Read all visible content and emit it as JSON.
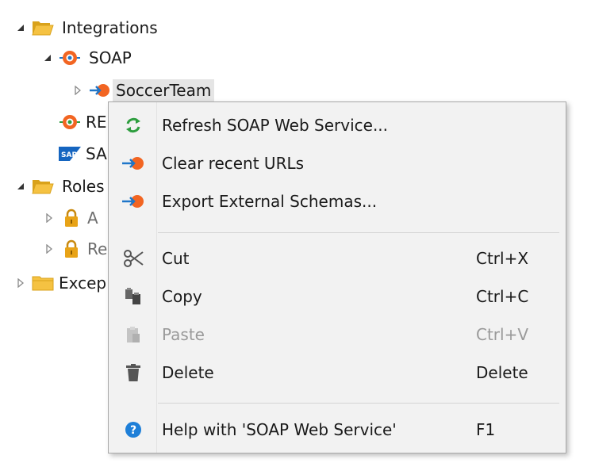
{
  "tree": {
    "integrations_label": "Integrations",
    "soap_label": "SOAP",
    "soccer_team_label": "SoccerTeam",
    "rest_label_partial": "RE",
    "sap_label_partial": "SA",
    "roles_label": "Roles",
    "role_a_partial": "A",
    "role_r_partial": "Re",
    "exceptions_partial": "Excep"
  },
  "context_menu": {
    "items": [
      {
        "label": "Refresh SOAP Web Service...",
        "shortcut": "",
        "icon": "refresh-icon"
      },
      {
        "label": "Clear recent URLs",
        "shortcut": "",
        "icon": "soap-import-icon"
      },
      {
        "label": "Export External Schemas...",
        "shortcut": "",
        "icon": "soap-export-icon"
      },
      {
        "label": "Cut",
        "shortcut": "Ctrl+X",
        "icon": "scissors-icon"
      },
      {
        "label": "Copy",
        "shortcut": "Ctrl+C",
        "icon": "copy-icon"
      },
      {
        "label": "Paste",
        "shortcut": "Ctrl+V",
        "icon": "paste-icon",
        "disabled": true
      },
      {
        "label": "Delete",
        "shortcut": "Delete",
        "icon": "trash-icon"
      },
      {
        "label": "Help with 'SOAP Web Service'",
        "shortcut": "F1",
        "icon": "help-icon"
      }
    ]
  },
  "colors": {
    "folder": "#f5c242",
    "folder_dark": "#d9a21b",
    "soap_orange": "#f26522",
    "soap_blue": "#1f76c9",
    "refresh_green": "#2e9e3f",
    "help_blue": "#1e7fd8",
    "lock_gold": "#e8a317"
  }
}
